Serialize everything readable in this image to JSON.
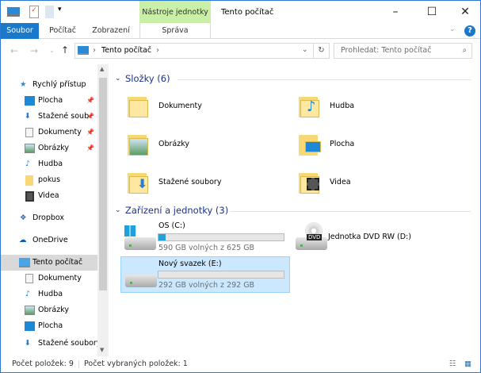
{
  "window": {
    "title": "Tento počítač",
    "context_tab": "Nástroje jednotky"
  },
  "ribbon": {
    "tabs": [
      "Soubor",
      "Počítač",
      "Zobrazení",
      "Správa"
    ]
  },
  "address": {
    "path": "Tento počítač",
    "search_placeholder": "Prohledat: Tento počítač"
  },
  "nav": {
    "quick_access": "Rychlý přístup",
    "quick_items": [
      "Plocha",
      "Stažené soub",
      "Dokumenty",
      "Obrázky",
      "Hudba",
      "pokus",
      "Videa"
    ],
    "dropbox": "Dropbox",
    "onedrive": "OneDrive",
    "this_pc": "Tento počítač",
    "pc_items": [
      "Dokumenty",
      "Hudba",
      "Obrázky",
      "Plocha",
      "Stažené soubory"
    ]
  },
  "folders": {
    "header": "Složky (6)",
    "items": [
      "Dokumenty",
      "Hudba",
      "Obrázky",
      "Plocha",
      "Stažené soubory",
      "Videa"
    ]
  },
  "devices": {
    "header": "Zařízení a jednotky (3)",
    "items": [
      {
        "name": "OS (C:)",
        "free": "590 GB volných z 625 GB",
        "used_fraction": 0.056
      },
      {
        "name": "Jednotka DVD RW (D:)"
      },
      {
        "name": "Nový svazek (E:)",
        "free": "292 GB volných z 292 GB",
        "used_fraction": 0.0
      }
    ],
    "dvd_label": "DVD"
  },
  "status": {
    "count": "Počet položek: 9",
    "selected": "Počet vybraných položek: 1"
  }
}
